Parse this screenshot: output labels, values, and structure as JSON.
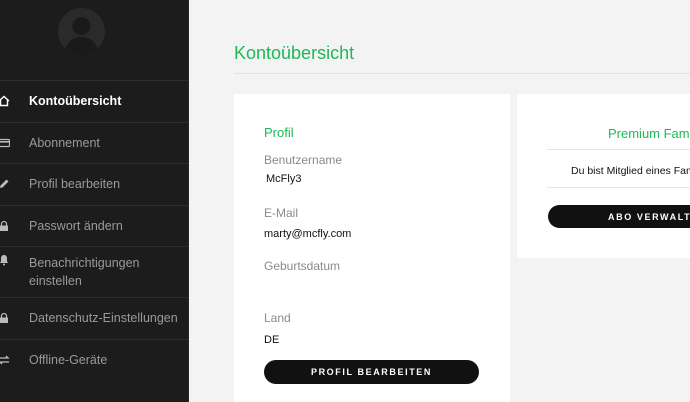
{
  "sidebar": {
    "items": [
      {
        "label": "Kontoübersicht",
        "icon": "home-icon",
        "active": true
      },
      {
        "label": "Abonnement",
        "icon": "card-icon"
      },
      {
        "label": "Profil bearbeiten",
        "icon": "pencil-icon"
      },
      {
        "label": "Passwort ändern",
        "icon": "lock-icon"
      },
      {
        "label": "Benachrichtigungen einstellen",
        "icon": "bell-icon"
      },
      {
        "label": "Datenschutz-Einstellungen",
        "icon": "lock-icon"
      },
      {
        "label": "Offline-Geräte",
        "icon": "sync-icon"
      }
    ]
  },
  "main": {
    "title": "Kontoübersicht"
  },
  "profile": {
    "title": "Profil",
    "username_label": "Benutzername",
    "username": "McFly3",
    "email_label": "E-Mail",
    "email": "marty@mcfly.com",
    "birthdate_label": "Geburtsdatum",
    "birthdate": "",
    "country_label": "Land",
    "country": "DE",
    "edit_button": "PROFIL BEARBEITEN"
  },
  "premium": {
    "title": "Premium Fami",
    "text": "Du bist Mitglied eines Fam",
    "button": "ABO VERWALTE"
  },
  "colors": {
    "accent": "#1db954",
    "sidebar_bg": "#1c1c1c",
    "page_bg": "#f3f3f3",
    "button_bg": "#111111"
  }
}
